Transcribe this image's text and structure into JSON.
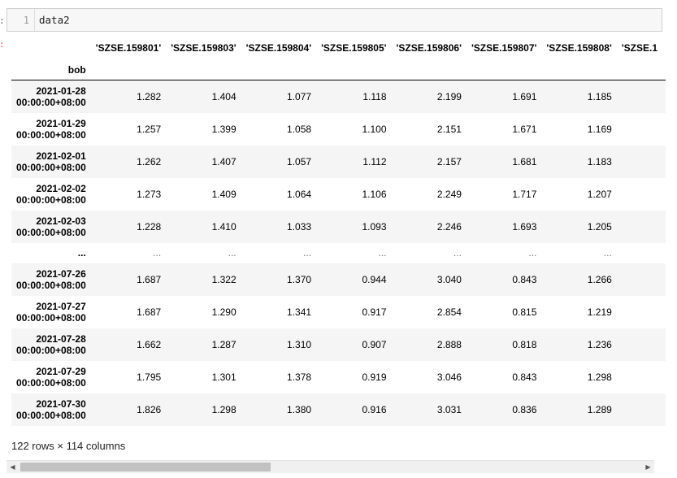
{
  "cell": {
    "line_number": "1",
    "code": "data2"
  },
  "table": {
    "index_name": "bob",
    "columns": [
      "'SZSE.159801'",
      "'SZSE.159803'",
      "'SZSE.159804'",
      "'SZSE.159805'",
      "'SZSE.159806'",
      "'SZSE.159807'",
      "'SZSE.159808'",
      "'SZSE.1"
    ],
    "rows_top": [
      {
        "date": "2021-01-28",
        "time": "00:00:00+08:00",
        "values": [
          "1.282",
          "1.404",
          "1.077",
          "1.118",
          "2.199",
          "1.691",
          "1.185"
        ]
      },
      {
        "date": "2021-01-29",
        "time": "00:00:00+08:00",
        "values": [
          "1.257",
          "1.399",
          "1.058",
          "1.100",
          "2.151",
          "1.671",
          "1.169"
        ]
      },
      {
        "date": "2021-02-01",
        "time": "00:00:00+08:00",
        "values": [
          "1.262",
          "1.407",
          "1.057",
          "1.112",
          "2.157",
          "1.681",
          "1.183"
        ]
      },
      {
        "date": "2021-02-02",
        "time": "00:00:00+08:00",
        "values": [
          "1.273",
          "1.409",
          "1.064",
          "1.106",
          "2.249",
          "1.717",
          "1.207"
        ]
      },
      {
        "date": "2021-02-03",
        "time": "00:00:00+08:00",
        "values": [
          "1.228",
          "1.410",
          "1.033",
          "1.093",
          "2.246",
          "1.693",
          "1.205"
        ]
      }
    ],
    "ellipsis": {
      "index": "...",
      "value": "..."
    },
    "rows_bottom": [
      {
        "date": "2021-07-26",
        "time": "00:00:00+08:00",
        "values": [
          "1.687",
          "1.322",
          "1.370",
          "0.944",
          "3.040",
          "0.843",
          "1.266"
        ]
      },
      {
        "date": "2021-07-27",
        "time": "00:00:00+08:00",
        "values": [
          "1.687",
          "1.290",
          "1.341",
          "0.917",
          "2.854",
          "0.815",
          "1.219"
        ]
      },
      {
        "date": "2021-07-28",
        "time": "00:00:00+08:00",
        "values": [
          "1.662",
          "1.287",
          "1.310",
          "0.907",
          "2.888",
          "0.818",
          "1.236"
        ]
      },
      {
        "date": "2021-07-29",
        "time": "00:00:00+08:00",
        "values": [
          "1.795",
          "1.301",
          "1.378",
          "0.919",
          "3.046",
          "0.843",
          "1.298"
        ]
      },
      {
        "date": "2021-07-30",
        "time": "00:00:00+08:00",
        "values": [
          "1.826",
          "1.298",
          "1.380",
          "0.916",
          "3.031",
          "0.836",
          "1.289"
        ]
      }
    ]
  },
  "summary": "122 rows × 114 columns",
  "scrollbar": {
    "left_arrow": "◀",
    "right_arrow": "▶"
  }
}
